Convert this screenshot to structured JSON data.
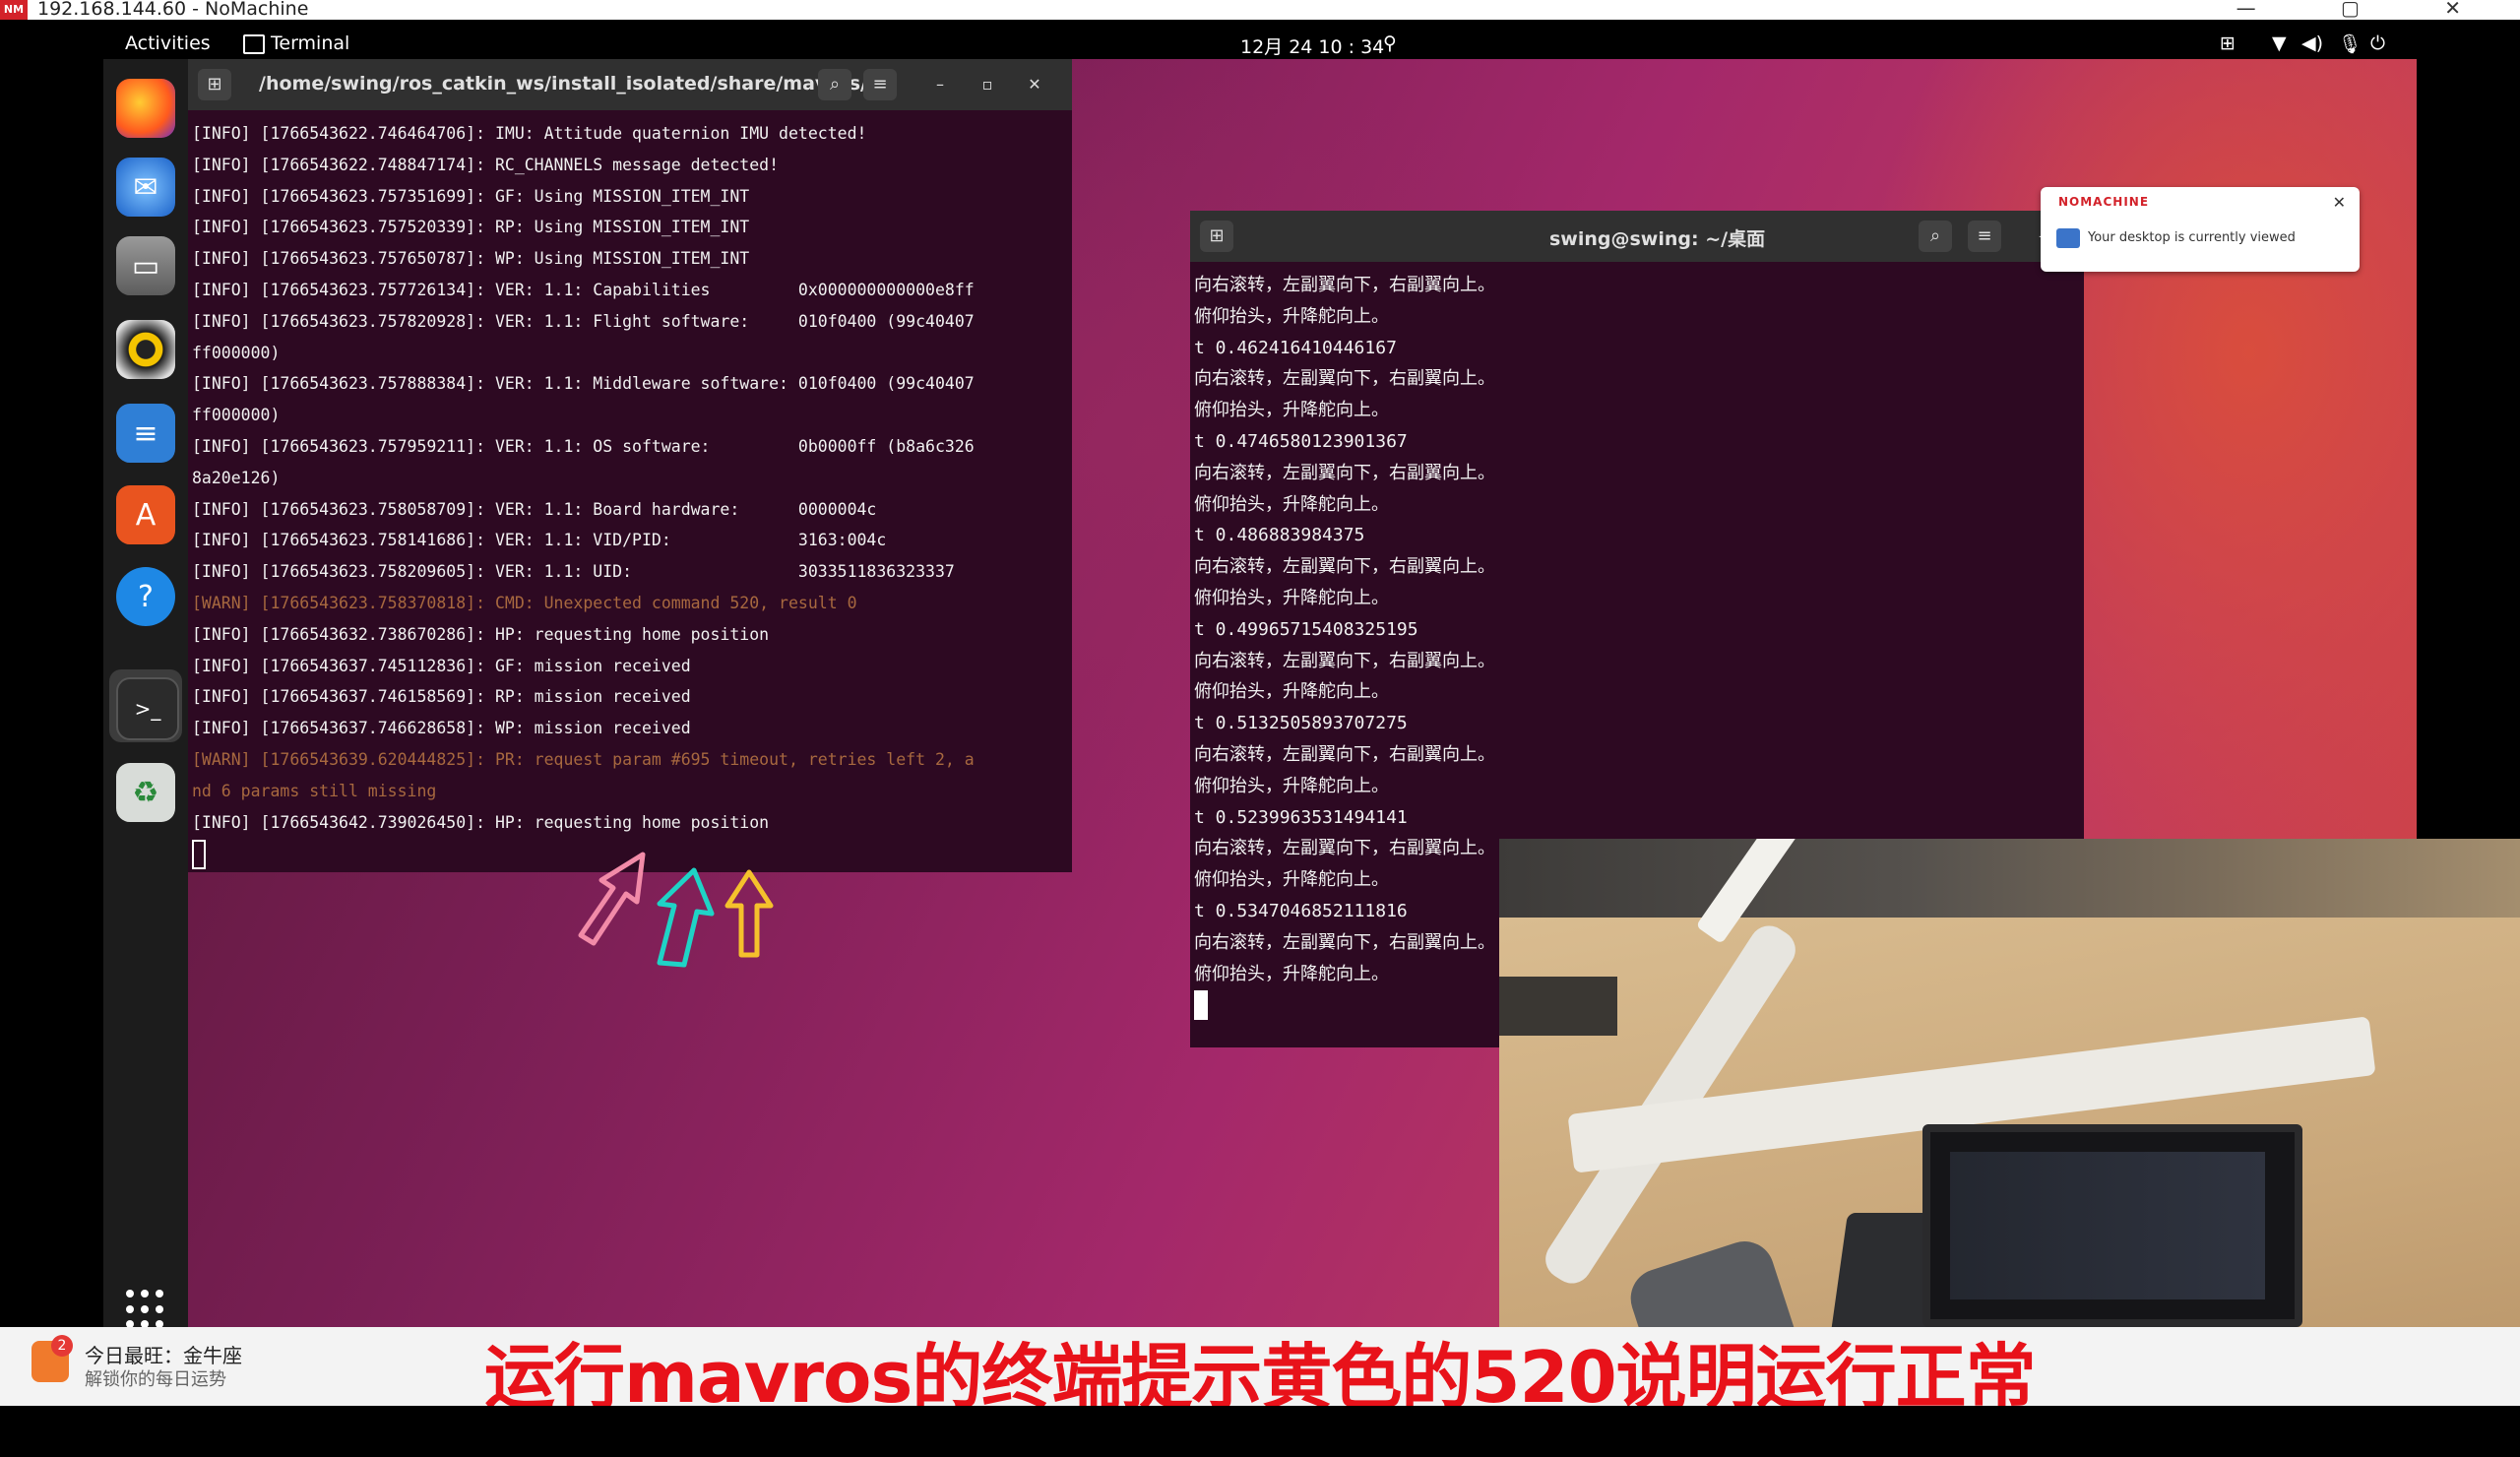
{
  "host": {
    "logo": "NM",
    "title": "192.168.144.60 - NoMachine"
  },
  "topbar": {
    "activities": "Activities",
    "app_name": "Terminal",
    "datetime": "12月 24  10 : 34"
  },
  "terminal_left": {
    "title": "/home/swing/ros_catkin_ws/install_isolated/share/mavros/l...",
    "lines": [
      {
        "text": "[INFO] [1766543622.746464706]: IMU: Attitude quaternion IMU detected!",
        "level": "info"
      },
      {
        "text": "[INFO] [1766543622.748847174]: RC_CHANNELS message detected!",
        "level": "info"
      },
      {
        "text": "[INFO] [1766543623.757351699]: GF: Using MISSION_ITEM_INT",
        "level": "info"
      },
      {
        "text": "[INFO] [1766543623.757520339]: RP: Using MISSION_ITEM_INT",
        "level": "info"
      },
      {
        "text": "[INFO] [1766543623.757650787]: WP: Using MISSION_ITEM_INT",
        "level": "info"
      },
      {
        "text": "[INFO] [1766543623.757726134]: VER: 1.1: Capabilities         0x000000000000e8ff",
        "level": "info"
      },
      {
        "text": "[INFO] [1766543623.757820928]: VER: 1.1: Flight software:     010f0400 (99c40407",
        "level": "info"
      },
      {
        "text": "ff000000)",
        "level": "info"
      },
      {
        "text": "[INFO] [1766543623.757888384]: VER: 1.1: Middleware software: 010f0400 (99c40407",
        "level": "info"
      },
      {
        "text": "ff000000)",
        "level": "info"
      },
      {
        "text": "[INFO] [1766543623.757959211]: VER: 1.1: OS software:         0b0000ff (b8a6c326",
        "level": "info"
      },
      {
        "text": "8a20e126)",
        "level": "info"
      },
      {
        "text": "[INFO] [1766543623.758058709]: VER: 1.1: Board hardware:      0000004c",
        "level": "info"
      },
      {
        "text": "[INFO] [1766543623.758141686]: VER: 1.1: VID/PID:             3163:004c",
        "level": "info"
      },
      {
        "text": "[INFO] [1766543623.758209605]: VER: 1.1: UID:                 3033511836323337",
        "level": "info"
      },
      {
        "text": "[WARN] [1766543623.758370818]: CMD: Unexpected command 520, result 0",
        "level": "warn"
      },
      {
        "text": "[INFO] [1766543632.738670286]: HP: requesting home position",
        "level": "info"
      },
      {
        "text": "[INFO] [1766543637.745112836]: GF: mission received",
        "level": "info"
      },
      {
        "text": "[INFO] [1766543637.746158569]: RP: mission received",
        "level": "info"
      },
      {
        "text": "[INFO] [1766543637.746628658]: WP: mission received",
        "level": "info"
      },
      {
        "text": "[WARN] [1766543639.620444825]: PR: request param #695 timeout, retries left 2, a",
        "level": "warn"
      },
      {
        "text": "nd 6 params still missing",
        "level": "warn"
      },
      {
        "text": "[INFO] [1766543642.739026450]: HP: requesting home position",
        "level": "info"
      }
    ]
  },
  "terminal_right": {
    "title": "swing@swing: ~/桌面",
    "lines": [
      "向右滚转，左副翼向下，右副翼向上。",
      "俯仰抬头，升降舵向上。",
      "t 0.462416410446167",
      "向右滚转，左副翼向下，右副翼向上。",
      "俯仰抬头，升降舵向上。",
      "t 0.4746580123901367",
      "向右滚转，左副翼向下，右副翼向上。",
      "俯仰抬头，升降舵向上。",
      "t 0.486883984375",
      "向右滚转，左副翼向下，右副翼向上。",
      "俯仰抬头，升降舵向上。",
      "t 0.49965715408325195",
      "向右滚转，左副翼向下，右副翼向上。",
      "俯仰抬头，升降舵向上。",
      "t 0.5132505893707275",
      "向右滚转，左副翼向下，右副翼向上。",
      "俯仰抬头，升降舵向上。",
      "t 0.5239963531494141",
      "向右滚转，左副翼向下，右副翼向上。",
      "俯仰抬头，升降舵向上。",
      "t 0.5347046852111816",
      "向右滚转，左副翼向下，右副翼向上。",
      "俯仰抬头，升降舵向上。"
    ]
  },
  "notification": {
    "brand": "NOMACHINE",
    "text": "Your desktop is currently viewed"
  },
  "fortune": {
    "badge": "2",
    "title": "今日最旺：金牛座",
    "subtitle": "解锁你的每日运势"
  },
  "subtitle_text": "运行mavros的终端提示黄色的520说明运行正常",
  "colors": {
    "subtitle": "#e8121a",
    "warn_text": "#a7683f",
    "arrow_pink": "#f28ba8",
    "arrow_cyan": "#1fd3c6",
    "arrow_yellow": "#f5c12c",
    "terminal_bg": "#2d0922"
  }
}
